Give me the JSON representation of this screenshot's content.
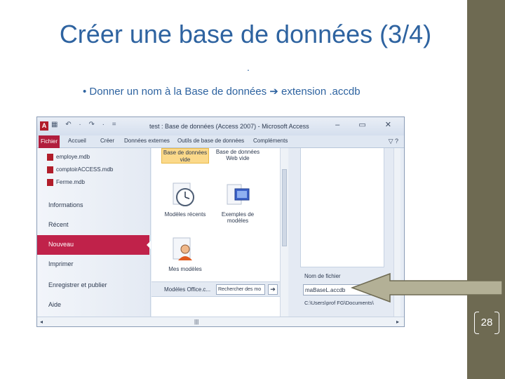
{
  "slide": {
    "title": "Créer une base de données (3/4)",
    "dot": ".",
    "bullet": "• Donner un nom à la Base de données ➔ extension .accdb",
    "page_number": "28",
    "colors": {
      "title": "#2e63a0",
      "band": "#6e6a52",
      "file_tab": "#b11d3d",
      "callout": "#b3b096"
    }
  },
  "window": {
    "app_icon": "A",
    "qat": "▦ ↶ · ↷ · =",
    "title": "test : Base de données (Access 2007) - Microsoft Access",
    "controls": "– ▭ ✕",
    "help": "▽ ?"
  },
  "ribbon": {
    "tabs": [
      "Fichier",
      "Accueil",
      "Créer",
      "Données externes",
      "Outils de base de données",
      "Compléments"
    ]
  },
  "recent_files": [
    "employe.mdb",
    "comptoirACCESS.mdb",
    "Ferme.mdb"
  ],
  "nav": {
    "items": [
      "Informations",
      "Récent",
      "Nouveau",
      "Imprimer",
      "Enregistrer et publier",
      "Aide"
    ],
    "active": "Nouveau"
  },
  "templates": {
    "selected_line1": "Base de données",
    "selected_line2": "vide",
    "web_line1": "Base de données",
    "web_line2": "Web vide",
    "recent_line1": "Modèles récents",
    "sample_line1": "Exemples de",
    "sample_line2": "modèles",
    "mine": "Mes modèles",
    "office_label": "Modèles Office.c...",
    "search_placeholder": "Rechercher des mo",
    "search_go": "➔"
  },
  "file_panel": {
    "name_label": "Nom de fichier",
    "name_value": "maBaseL.accdb",
    "path": "C:\\Users\\prof FG\\Documents\\"
  },
  "hscroll": {
    "left": "◂",
    "mid": "|||",
    "right": "▸"
  }
}
